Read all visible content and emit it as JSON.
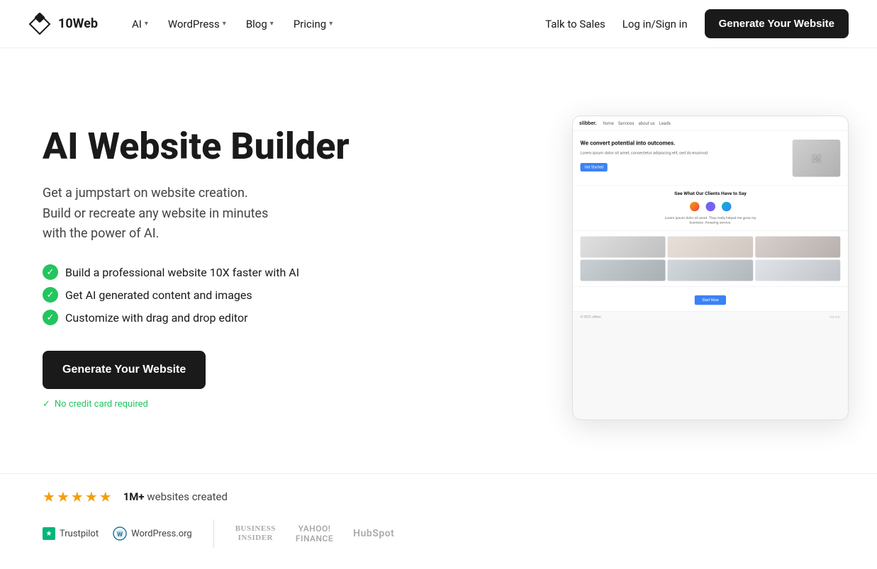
{
  "brand": {
    "name": "10Web",
    "logo_icon": "diamond"
  },
  "nav": {
    "items": [
      {
        "label": "AI",
        "has_dropdown": true
      },
      {
        "label": "WordPress",
        "has_dropdown": true
      },
      {
        "label": "Blog",
        "has_dropdown": true
      },
      {
        "label": "Pricing",
        "has_dropdown": true
      }
    ],
    "right_links": [
      {
        "label": "Talk to Sales"
      },
      {
        "label": "Log in/Sign in"
      }
    ],
    "cta_label": "Generate Your Website"
  },
  "hero": {
    "title": "AI Website Builder",
    "subtitle": "Get a jumpstart on website creation.\nBuild or recreate any website in minutes\nwith the power of AI.",
    "features": [
      "Build a professional website 10X faster with AI",
      "Get AI generated content and images",
      "Customize with drag and drop editor"
    ],
    "cta_label": "Generate Your Website",
    "no_credit": "No credit card required"
  },
  "preview": {
    "site_name": "slibber.",
    "nav_links": [
      "home",
      "Services",
      "about us",
      "Leads"
    ],
    "hero_text": "We convert potential into outcomes.",
    "hero_subtext": "Lorem ipsum dolor sit amet, consectetur adipiscing elit.",
    "hero_btn": "Get Started",
    "section_title": "See What Our Clients Have to Say",
    "testimonial_text": "Lorem ipsum dolor sit amet. They really helped me grow my business. Amazing service.",
    "cta_btn": "Start Now",
    "footer_text": "© 2023 slibber."
  },
  "social_proof": {
    "stars": 4.5,
    "count": "1M+",
    "count_label": "websites created",
    "trustpilot": "Trustpilot",
    "wordpress": "WordPress.org",
    "press_logos": [
      {
        "name": "Business Insider",
        "display": "BUSINESS\nINSIDER"
      },
      {
        "name": "Yahoo Finance",
        "display": "YAHOO!\nFINANCE"
      },
      {
        "name": "HubSpot",
        "display": "HubSpot"
      }
    ]
  }
}
